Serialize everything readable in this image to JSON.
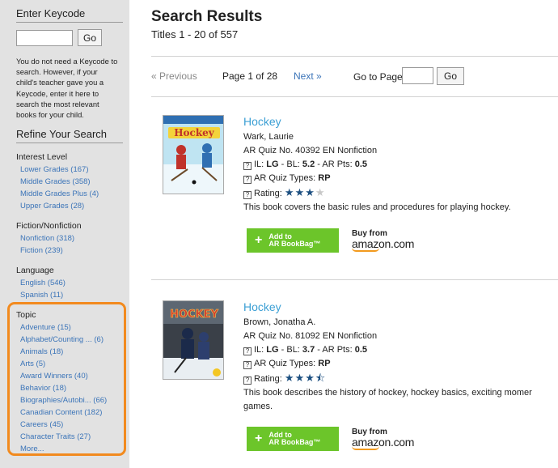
{
  "sidebar": {
    "keycode_heading": "Enter Keycode",
    "keycode_button": "Go",
    "keycode_note": "You do not need a Keycode to search. However, if your child's teacher gave you a Keycode, enter it here to search the most relevant books for your child.",
    "refine_heading": "Refine Your Search",
    "interest": {
      "title": "Interest Level",
      "items": [
        "Lower Grades (167)",
        "Middle Grades (358)",
        "Middle Grades Plus (4)",
        "Upper Grades (28)"
      ]
    },
    "fiction": {
      "title": "Fiction/Nonfiction",
      "items": [
        "Nonfiction (318)",
        "Fiction (239)"
      ]
    },
    "language": {
      "title": "Language",
      "items": [
        "English (546)",
        "Spanish (11)"
      ]
    },
    "topic": {
      "title": "Topic",
      "items": [
        "Adventure (15)",
        "Alphabet/Counting ... (6)",
        "Animals (18)",
        "Arts (5)",
        "Award Winners (40)",
        "Behavior (18)",
        "Biographies/Autobi... (66)",
        "Canadian Content (182)",
        "Careers (45)",
        "Character Traits (27)"
      ],
      "more": "More..."
    },
    "highlight_color": "#f28a1e"
  },
  "main": {
    "title": "Search Results",
    "count": "Titles 1 - 20 of 557",
    "pager": {
      "prev": "« Previous",
      "page_label": "Page 1 of 28",
      "next": "Next »",
      "goto_label": "Go to Page",
      "go_button": "Go"
    },
    "books": [
      {
        "title": "Hockey",
        "author": "Wark, Laurie",
        "quiz": "AR Quiz No. 40392 EN Nonfiction",
        "il_prefix": "IL: ",
        "il": "LG",
        "bl_prefix": " - BL: ",
        "bl": "5.2",
        "pts_prefix": " - AR Pts: ",
        "pts": "0.5",
        "types_prefix": "AR Quiz Types: ",
        "types": "RP",
        "rating_label": "Rating: ",
        "rating": 3,
        "description": "This book covers the basic rules and procedures for playing hockey.",
        "cover_title": "Hockey"
      },
      {
        "title": "Hockey",
        "author": "Brown, Jonatha A.",
        "quiz": "AR Quiz No. 81092 EN Nonfiction",
        "il_prefix": "IL: ",
        "il": "LG",
        "bl_prefix": " - BL: ",
        "bl": "3.7",
        "pts_prefix": " - AR Pts: ",
        "pts": "0.5",
        "types_prefix": "AR Quiz Types: ",
        "types": "RP",
        "rating_label": "Rating: ",
        "rating": 3.5,
        "description": "This book describes the history of hockey, hockey basics, exciting momer",
        "description2": "games.",
        "cover_title": "HOCKEY"
      }
    ],
    "add_button_line1": "Add to",
    "add_button_line2": "AR BookBag™",
    "amazon_buy": "Buy from",
    "amazon_logo": "amazon.com",
    "accent_green": "#6cc52a",
    "link_blue": "#3b74b8"
  }
}
